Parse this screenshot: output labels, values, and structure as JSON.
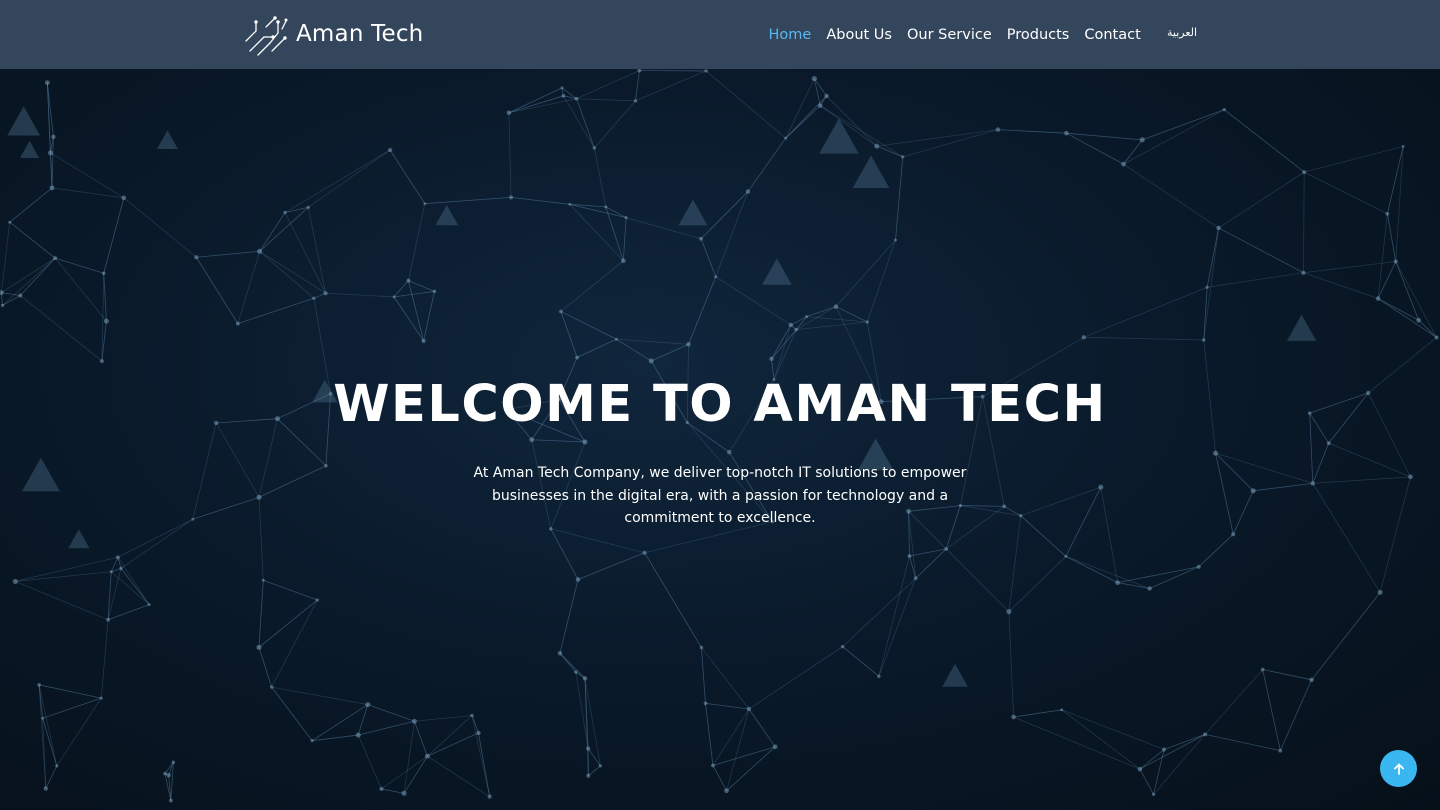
{
  "brand": {
    "name": "Aman Tech",
    "logo_icon": "circuit-arabic-logo-icon"
  },
  "nav": {
    "items": [
      {
        "label": "Home",
        "active": true
      },
      {
        "label": "About Us",
        "active": false
      },
      {
        "label": "Our Service",
        "active": false
      },
      {
        "label": "Products",
        "active": false
      },
      {
        "label": "Contact",
        "active": false
      }
    ],
    "language_label": "العربية"
  },
  "hero": {
    "title": "WELCOME TO AMAN TECH",
    "text": "At Aman Tech Company, we deliver top-notch IT solutions to empower businesses in the digital era, with a passion for technology and a commitment to excellence."
  },
  "scroll_top": {
    "icon": "arrow-up-icon"
  },
  "colors": {
    "navbar": "#34465c",
    "active_link": "#5bb7ef",
    "hero_background": "#0a1a2b",
    "scroll_top_button": "#3ab7f0"
  }
}
